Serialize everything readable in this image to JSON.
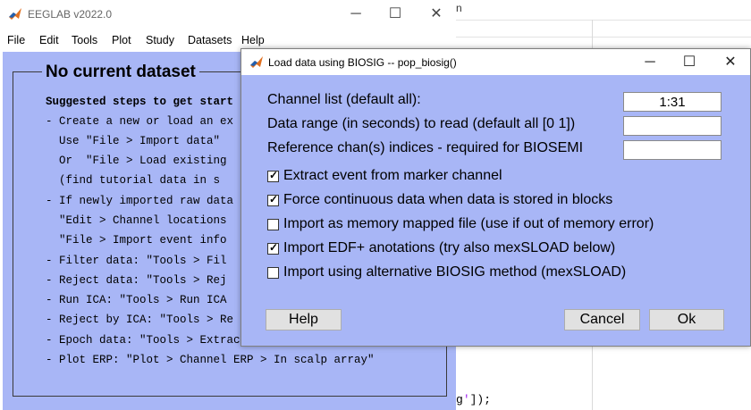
{
  "background_editor": {
    "top_text": "n",
    "code_prefix": "g",
    "code_string": "'",
    "code_suffix": "]);"
  },
  "eeglab": {
    "title": "EEGLAB v2022.0",
    "menu": [
      "File",
      "Edit",
      "Tools",
      "Plot",
      "Study",
      "Datasets",
      "Help"
    ],
    "frame_title": "No current dataset",
    "steps": [
      "Suggested steps to get start",
      "- Create a new or load an ex",
      "  Use \"File > Import data\"",
      "  Or  \"File > Load existing",
      "  (find tutorial data in s",
      "- If newly imported raw data",
      "  \"Edit > Channel locations",
      "  \"File > Import event info",
      "- Filter data: \"Tools > Fil",
      "- Reject data: \"Tools > Rej",
      "- Run ICA: \"Tools > Run ICA",
      "- Reject by ICA: \"Tools > Re",
      "- Epoch data: \"Tools > Extract epochs\"",
      "- Plot ERP: \"Plot > Channel ERP > In scalp array\""
    ]
  },
  "dialog": {
    "title": "Load data using BIOSIG -- pop_biosig()",
    "fields": [
      {
        "label": "Channel list (default all):",
        "value": "1:31",
        "placeholder": ""
      },
      {
        "label": "Data range (in seconds) to read (default all [0 1])",
        "value": "",
        "placeholder": ""
      },
      {
        "label": "Reference chan(s) indices - required for BIOSEMI",
        "value": "",
        "placeholder": ""
      }
    ],
    "checkboxes": [
      {
        "label": "Extract event from marker channel",
        "checked": true
      },
      {
        "label": "Force continuous data when data is stored in blocks",
        "checked": true
      },
      {
        "label": "Import as memory mapped file (use if out of memory error)",
        "checked": false
      },
      {
        "label": "Import EDF+ anotations (try also mexSLOAD below)",
        "checked": true
      },
      {
        "label": "Import using alternative BIOSIG method (mexSLOAD)",
        "checked": false
      }
    ],
    "buttons": {
      "help": "Help",
      "cancel": "Cancel",
      "ok": "Ok"
    }
  },
  "colors": {
    "panel_bg": "#a8b6f6",
    "button_bg": "#e1e1e1"
  },
  "icons": {
    "minimize": "─",
    "maximize": "☐",
    "close": "✕",
    "check": "✓"
  }
}
